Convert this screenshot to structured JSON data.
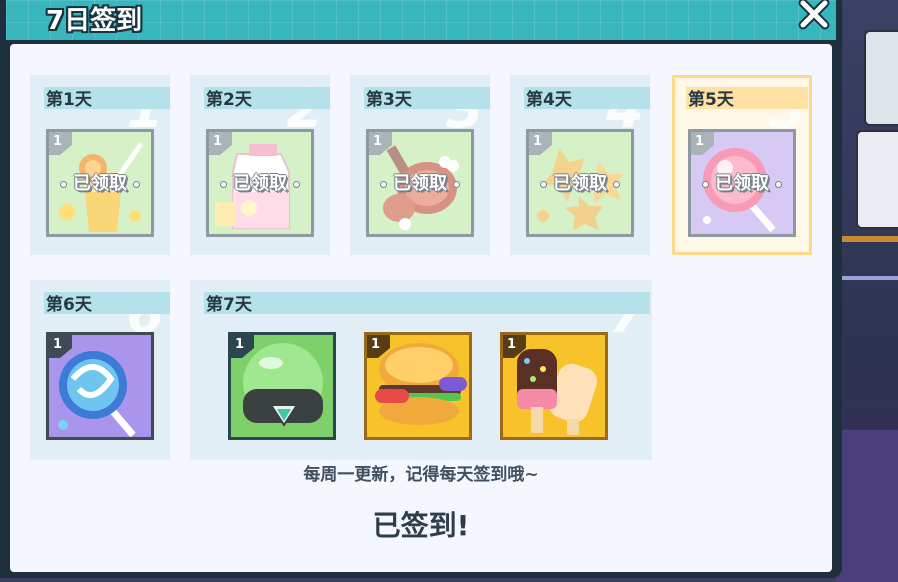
{
  "dialog": {
    "title": "7日签到",
    "close_icon": "close-icon"
  },
  "days": [
    {
      "label": "第1天",
      "number": "1",
      "items": [
        {
          "icon": "juice-drink-icon",
          "count": "1",
          "status": "已领取"
        }
      ]
    },
    {
      "label": "第2天",
      "number": "2",
      "items": [
        {
          "icon": "milk-carton-icon",
          "count": "1",
          "status": "已领取"
        }
      ]
    },
    {
      "label": "第3天",
      "number": "3",
      "items": [
        {
          "icon": "meat-drumstick-icon",
          "count": "1",
          "status": "已领取"
        }
      ]
    },
    {
      "label": "第4天",
      "number": "4",
      "items": [
        {
          "icon": "cookies-icon",
          "count": "1",
          "status": "已领取"
        }
      ]
    },
    {
      "label": "第5天",
      "number": "5",
      "items": [
        {
          "icon": "pink-lollipop-icon",
          "count": "1",
          "status": "已领取"
        }
      ]
    },
    {
      "label": "第6天",
      "number": "6",
      "items": [
        {
          "icon": "blue-lollipop-icon",
          "count": "1",
          "status": ""
        }
      ]
    },
    {
      "label": "第7天",
      "number": "7",
      "items": [
        {
          "icon": "green-capsule-icon",
          "count": "1",
          "status": ""
        },
        {
          "icon": "burger-icon",
          "count": "1",
          "status": ""
        },
        {
          "icon": "ice-cream-bars-icon",
          "count": "1",
          "status": ""
        }
      ]
    }
  ],
  "notice": "每周一更新，记得每天签到哦~",
  "status": "已签到!",
  "colors": {
    "header": "#38b6bd",
    "active_card": "#ffd98a",
    "panel_bg": "#f4f7fe",
    "claimed_text": "#ffffff"
  }
}
